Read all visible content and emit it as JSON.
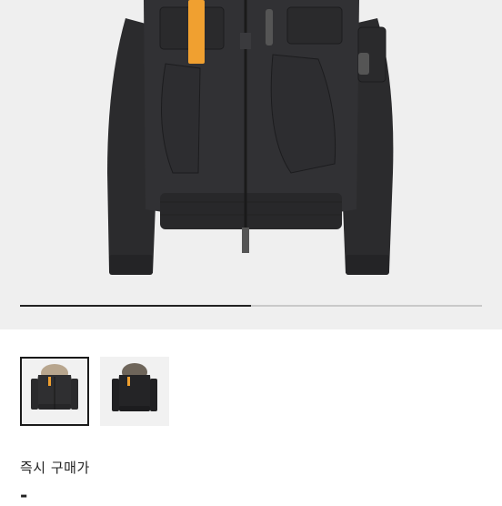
{
  "gallery": {
    "current_index": 1,
    "total_images": 2,
    "progress_fraction": 0.5
  },
  "thumbnails": [
    {
      "alt": "jacket-front-fur-hood",
      "selected": true
    },
    {
      "alt": "jacket-front-dark-fur-hood",
      "selected": false
    }
  ],
  "price": {
    "label": "즉시 구매가",
    "value": "-"
  },
  "colors": {
    "jacket": "#2c2c2e",
    "accent_tab": "#f0a030",
    "selected_border": "#1a1a1a"
  }
}
